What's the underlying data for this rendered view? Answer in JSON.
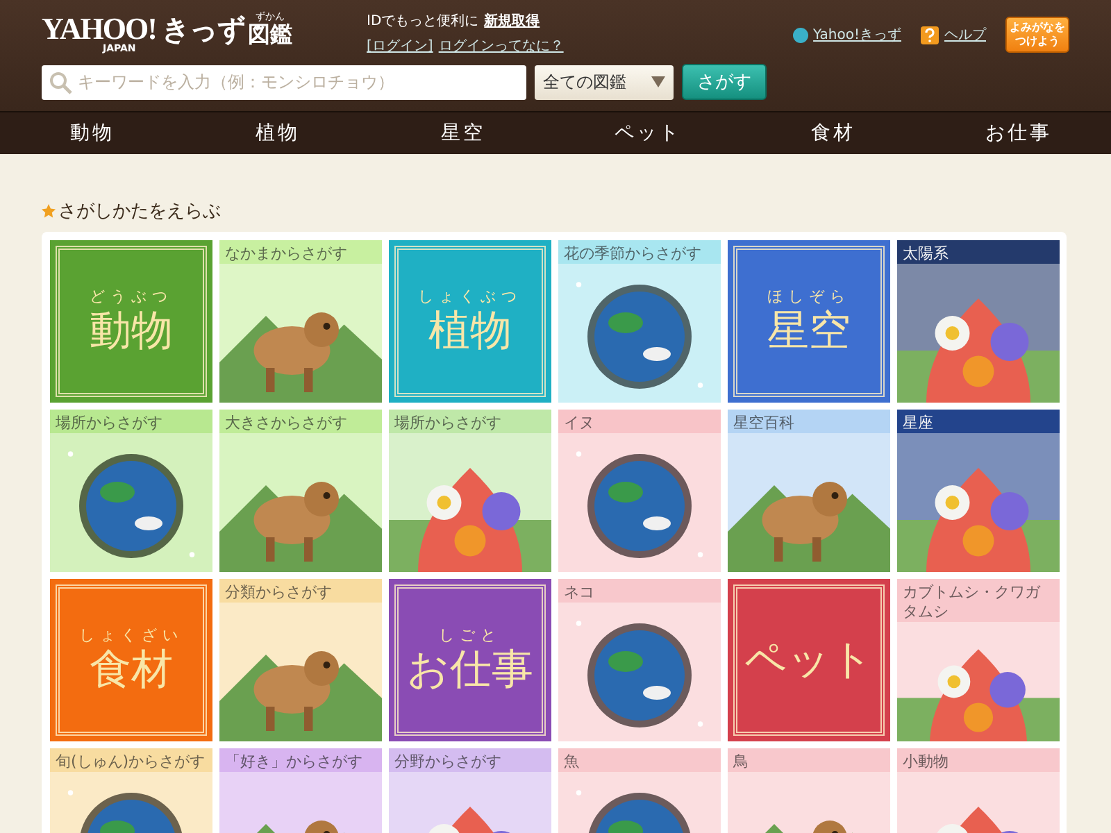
{
  "header": {
    "logo": {
      "brand": "YAHOO!",
      "sub": "JAPAN",
      "kids": "きっず",
      "book": "図鑑",
      "book_ruby": "ずかん"
    },
    "account": {
      "lead": "IDでもっと便利に",
      "signup": "新規取得",
      "login": "[ログイン]",
      "about": "ログインってなに？"
    },
    "links": [
      {
        "kind": "site",
        "label": "Yahoo!きっず"
      },
      {
        "kind": "help",
        "label": "ヘルプ"
      }
    ],
    "furigana_button": [
      "よみがなを",
      "つけよう"
    ],
    "search": {
      "placeholder": "キーワードを入力（例：モンシロチョウ）",
      "scope": "全ての図鑑",
      "button": "さがす"
    }
  },
  "nav": [
    "動物",
    "植物",
    "星空",
    "ペット",
    "食材",
    "お仕事"
  ],
  "section": {
    "title": "さがしかたをえらぶ"
  },
  "tiles": [
    {
      "kind": "category",
      "title": "動物",
      "ruby": "どうぶつ",
      "color": "#5aa232"
    },
    {
      "kind": "picture",
      "label": "なかまからさがす",
      "color": "#c8f0a0"
    },
    {
      "kind": "category",
      "title": "植物",
      "ruby": "しょくぶつ",
      "color": "#1fb0c4"
    },
    {
      "kind": "picture",
      "label": "花の季節からさがす",
      "color": "#a8e6f0"
    },
    {
      "kind": "category",
      "title": "星空",
      "ruby": "ほしぞら",
      "color": "#3e6fd0"
    },
    {
      "kind": "picture",
      "label": "太陽系",
      "color": "#243a6c"
    },
    {
      "kind": "picture",
      "label": "場所からさがす",
      "color": "#b8e890"
    },
    {
      "kind": "picture",
      "label": "大きさからさがす",
      "color": "#c0ec98"
    },
    {
      "kind": "picture",
      "label": "場所からさがす",
      "color": "#bfe8a8"
    },
    {
      "kind": "picture",
      "label": "イヌ",
      "color": "#f8c4c8"
    },
    {
      "kind": "picture",
      "label": "星空百科",
      "color": "#b4d4f4"
    },
    {
      "kind": "picture",
      "label": "星座",
      "color": "#23448c"
    },
    {
      "kind": "category",
      "title": "食材",
      "ruby": "しょくざい",
      "color": "#f36c10"
    },
    {
      "kind": "picture",
      "label": "分類からさがす",
      "color": "#f8dca0"
    },
    {
      "kind": "category",
      "title": "お仕事",
      "ruby": "しごと",
      "color": "#8a4cb4"
    },
    {
      "kind": "picture",
      "label": "ネコ",
      "color": "#f8c8cc"
    },
    {
      "kind": "category",
      "title": "ペット",
      "color": "#d4404c"
    },
    {
      "kind": "picture",
      "label": "カブトムシ・クワガタムシ",
      "color": "#f8c8cc"
    },
    {
      "kind": "picture",
      "label": "旬(しゅん)からさがす",
      "color": "#f8dca0"
    },
    {
      "kind": "picture",
      "label": "「好き」からさがす",
      "color": "#d8b4f0"
    },
    {
      "kind": "picture",
      "label": "分野からさがす",
      "color": "#d4bcf0"
    },
    {
      "kind": "picture",
      "label": "魚",
      "color": "#f8c8cc"
    },
    {
      "kind": "picture",
      "label": "鳥",
      "color": "#f8c8cc"
    },
    {
      "kind": "picture",
      "label": "小動物",
      "color": "#f8c8cc"
    }
  ]
}
